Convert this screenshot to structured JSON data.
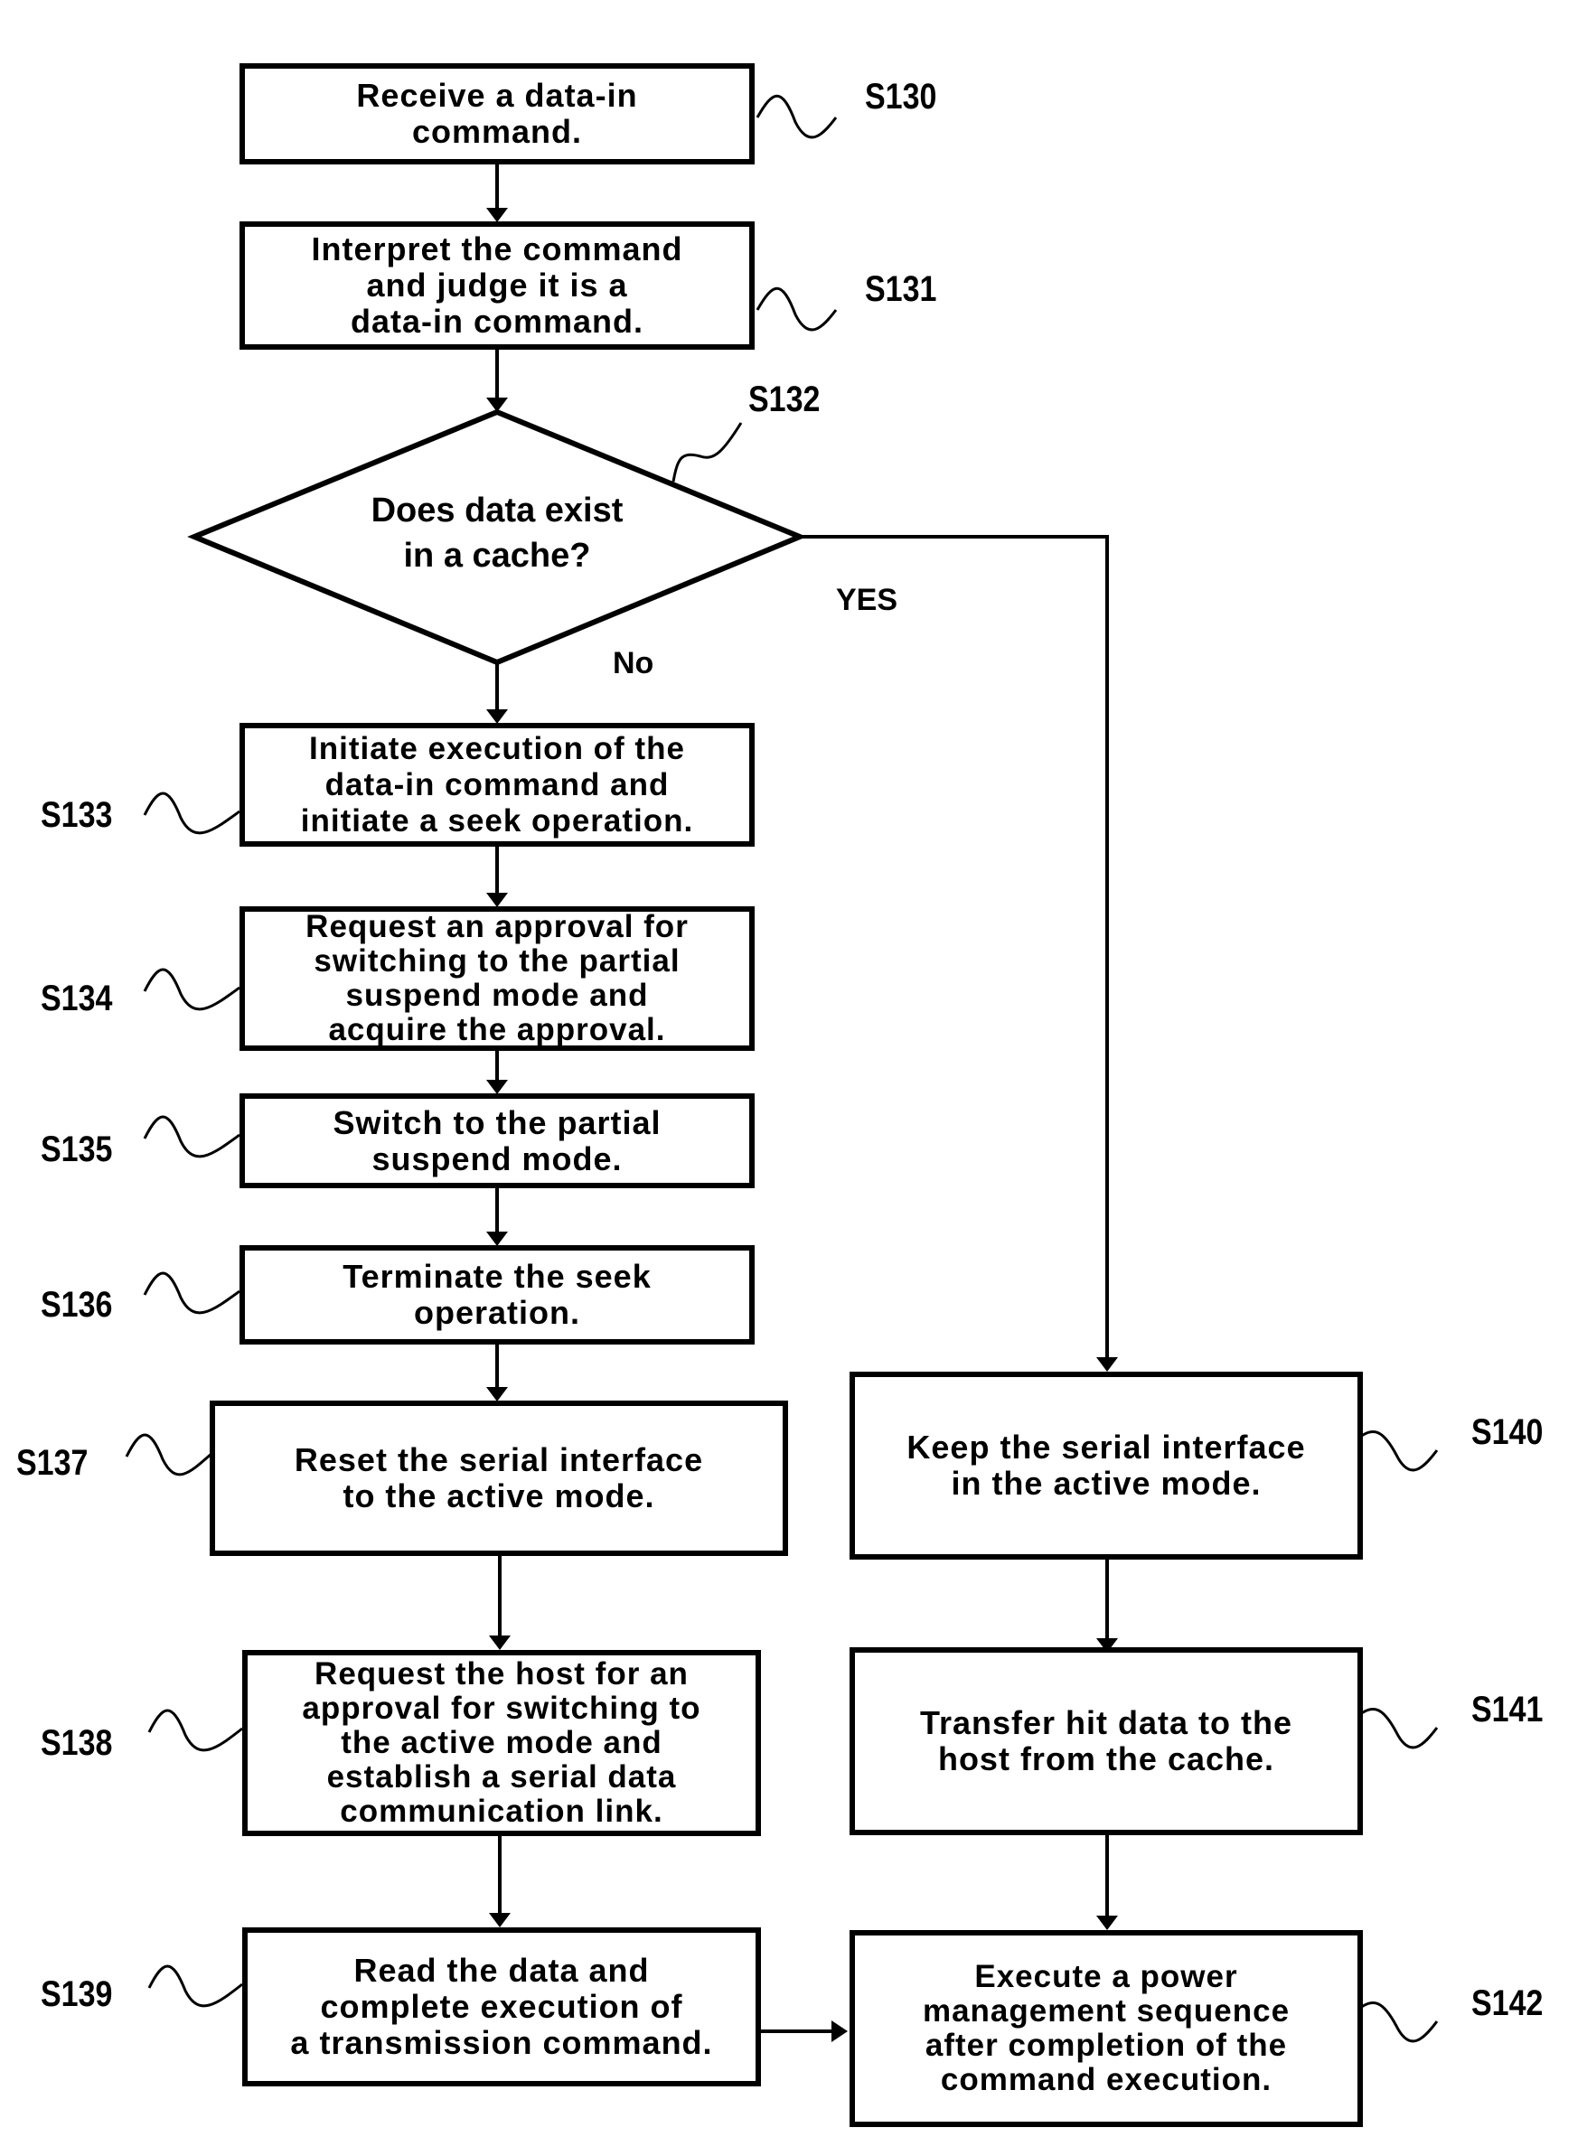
{
  "steps": {
    "s130": {
      "id": "S130",
      "text": "Receive a data-in\ncommand."
    },
    "s131": {
      "id": "S131",
      "text": "Interpret the command\nand judge it is a\ndata-in command."
    },
    "s132": {
      "id": "S132",
      "text": "Does data exist\nin a cache?"
    },
    "s133": {
      "id": "S133",
      "text": "Initiate execution of the\ndata-in command and\ninitiate a seek operation."
    },
    "s134": {
      "id": "S134",
      "text": "Request an approval for\nswitching to the partial\nsuspend mode and\nacquire the approval."
    },
    "s135": {
      "id": "S135",
      "text": "Switch to the partial\nsuspend mode."
    },
    "s136": {
      "id": "S136",
      "text": "Terminate the seek\noperation."
    },
    "s137": {
      "id": "S137",
      "text": "Reset the serial interface\nto the active mode."
    },
    "s138": {
      "id": "S138",
      "text": "Request the host for an\napproval for switching to\nthe active mode and\nestablish a serial data\ncommunication link."
    },
    "s139": {
      "id": "S139",
      "text": "Read the data and\ncomplete execution of\na transmission command."
    },
    "s140": {
      "id": "S140",
      "text": "Keep the serial interface\nin the active mode."
    },
    "s141": {
      "id": "S141",
      "text": "Transfer hit data to the\nhost from the cache."
    },
    "s142": {
      "id": "S142",
      "text": "Execute a power\nmanagement sequence\nafter completion of the\ncommand execution."
    }
  },
  "branches": {
    "yes": "YES",
    "no": "No"
  }
}
